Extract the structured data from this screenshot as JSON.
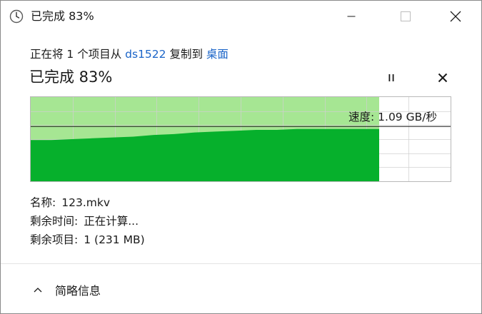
{
  "window": {
    "title": "已完成 83%",
    "icon": "clock-icon"
  },
  "header": {
    "subtitle_prefix": "正在将 1 个项目从 ",
    "source": "ds1522",
    "subtitle_mid": " 复制到 ",
    "destination": "桌面",
    "percent_title": "已完成 83%",
    "link_color": "#1a64c8"
  },
  "controls": {
    "pause_icon": "pause-icon",
    "cancel_icon": "close-icon"
  },
  "graph": {
    "speed_text": "速度: 1.09 GB/秒",
    "progress": 0.83,
    "current_speed_fraction": 0.62,
    "fill_color": "#06b02c",
    "progress_bg_color": "#a6e693",
    "speed_profile": [
      0.49,
      0.49,
      0.5,
      0.51,
      0.52,
      0.53,
      0.55,
      0.56,
      0.58,
      0.59,
      0.6,
      0.61,
      0.61,
      0.62,
      0.62,
      0.62,
      0.62,
      0.62
    ]
  },
  "info": {
    "name_label": "名称:",
    "name_value": "123.mkv",
    "time_label": "剩余时间:",
    "time_value": "正在计算...",
    "items_label": "剩余项目:",
    "items_value": "1 (231 MB)"
  },
  "footer": {
    "toggle_label": "简略信息",
    "toggle_icon": "chevron-up-icon"
  }
}
